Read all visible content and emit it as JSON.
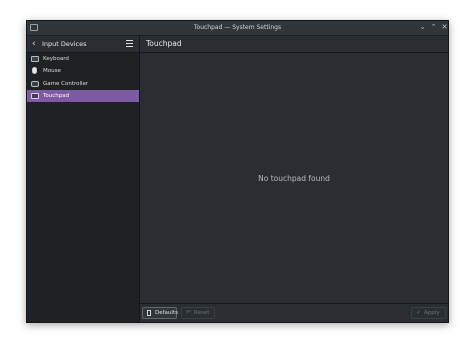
{
  "window": {
    "title": "Touchpad — System Settings",
    "controls": {
      "minimize": "⌄",
      "maximize": "⌃",
      "close": "✕"
    }
  },
  "sidebar": {
    "back_icon": "‹",
    "title": "Input Devices",
    "items": [
      {
        "label": "Keyboard",
        "icon": "keyboard-icon",
        "selected": false
      },
      {
        "label": "Mouse",
        "icon": "mouse-icon",
        "selected": false
      },
      {
        "label": "Game Controller",
        "icon": "game-controller-icon",
        "selected": false
      },
      {
        "label": "Touchpad",
        "icon": "touchpad-icon",
        "selected": true
      }
    ]
  },
  "main": {
    "title": "Touchpad",
    "empty_message": "No touchpad found"
  },
  "footer": {
    "defaults_label": "Defaults",
    "reset_label": "Reset",
    "reset_icon": "↶",
    "apply_label": "Apply",
    "apply_icon": "✓"
  },
  "colors": {
    "accent": "#7d5aa3",
    "window_bg": "#2a2e32",
    "sidebar_bg": "#1f2225"
  }
}
